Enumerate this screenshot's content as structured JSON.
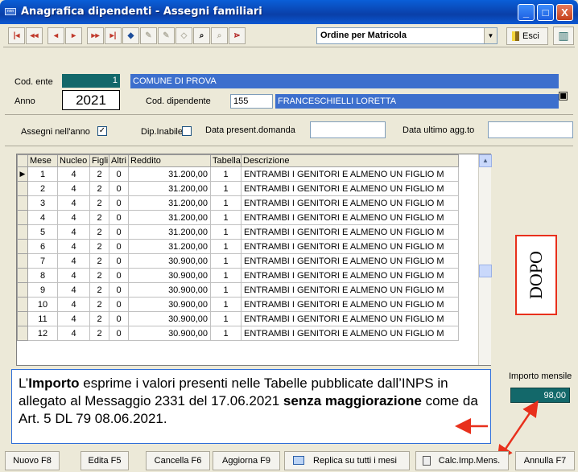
{
  "window": {
    "app_icon_text": "nnn",
    "title": "Anagrafica dipendenti - Assegni familiari",
    "min": "_",
    "max": "□",
    "close": "X"
  },
  "toolbar": {
    "ordine_value": "Ordine per Matricola",
    "esci_label": "Esci"
  },
  "header": {
    "cod_ente_label": "Cod. ente",
    "cod_ente_value": "1",
    "ente_name": "COMUNE DI PROVA",
    "anno_label": "Anno",
    "anno_value": "2021",
    "cod_dip_label": "Cod. dipendente",
    "cod_dip_value": "155",
    "dip_name": "FRANCESCHIELLI LORETTA"
  },
  "options": {
    "assegni_label": "Assegni nell'anno",
    "assegni_checked": "✓",
    "inabile_label": "Dip.Inabile",
    "data_domanda_label": "Data present.domanda",
    "data_agg_label": "Data ultimo agg.to"
  },
  "grid": {
    "columns": [
      "Mese",
      "Nucleo",
      "Figli",
      "Altri",
      "Reddito",
      "Tabella",
      "Descrizione"
    ],
    "rows": [
      [
        "1",
        "4",
        "2",
        "0",
        "31.200,00",
        "1",
        "ENTRAMBI I GENITORI E ALMENO UN FIGLIO M"
      ],
      [
        "2",
        "4",
        "2",
        "0",
        "31.200,00",
        "1",
        "ENTRAMBI I GENITORI E ALMENO UN FIGLIO M"
      ],
      [
        "3",
        "4",
        "2",
        "0",
        "31.200,00",
        "1",
        "ENTRAMBI I GENITORI E ALMENO UN FIGLIO M"
      ],
      [
        "4",
        "4",
        "2",
        "0",
        "31.200,00",
        "1",
        "ENTRAMBI I GENITORI E ALMENO UN FIGLIO M"
      ],
      [
        "5",
        "4",
        "2",
        "0",
        "31.200,00",
        "1",
        "ENTRAMBI I GENITORI E ALMENO UN FIGLIO M"
      ],
      [
        "6",
        "4",
        "2",
        "0",
        "31.200,00",
        "1",
        "ENTRAMBI I GENITORI E ALMENO UN FIGLIO M"
      ],
      [
        "7",
        "4",
        "2",
        "0",
        "30.900,00",
        "1",
        "ENTRAMBI I GENITORI E ALMENO UN FIGLIO M"
      ],
      [
        "8",
        "4",
        "2",
        "0",
        "30.900,00",
        "1",
        "ENTRAMBI I GENITORI E ALMENO UN FIGLIO M"
      ],
      [
        "9",
        "4",
        "2",
        "0",
        "30.900,00",
        "1",
        "ENTRAMBI I GENITORI E ALMENO UN FIGLIO M"
      ],
      [
        "10",
        "4",
        "2",
        "0",
        "30.900,00",
        "1",
        "ENTRAMBI I GENITORI E ALMENO UN FIGLIO M"
      ],
      [
        "11",
        "4",
        "2",
        "0",
        "30.900,00",
        "1",
        "ENTRAMBI I GENITORI E ALMENO UN FIGLIO M"
      ],
      [
        "12",
        "4",
        "2",
        "0",
        "30.900,00",
        "1",
        "ENTRAMBI I GENITORI E ALMENO UN FIGLIO M"
      ]
    ]
  },
  "side": {
    "dopo": "DOPO",
    "importo_label": "Importo mensile",
    "importo_value": "98,00"
  },
  "annotation": {
    "part1": "L’",
    "part2_bold": "Importo",
    "part3": " esprime i valori presenti nelle Tabelle pubblicate dall’INPS in allegato al Messaggio 2331 del 17.06.2021 ",
    "part4_bold": "senza maggiorazione",
    "part5": " come da Art. 5 DL 79 08.06.2021."
  },
  "footer": {
    "nuovo": "Nuovo F8",
    "edita": "Edita F5",
    "cancella": "Cancella F6",
    "aggiorna": "Aggiorna F9",
    "replica": "Replica su tutti i mesi",
    "calc": "Calc.Imp.Mens.",
    "annulla": "Annulla F7"
  },
  "colors": {
    "title_blue": "#0a5fd8",
    "field_blue": "#3d6fcd",
    "teal": "#13686a",
    "annotation_red": "#e8301c"
  }
}
